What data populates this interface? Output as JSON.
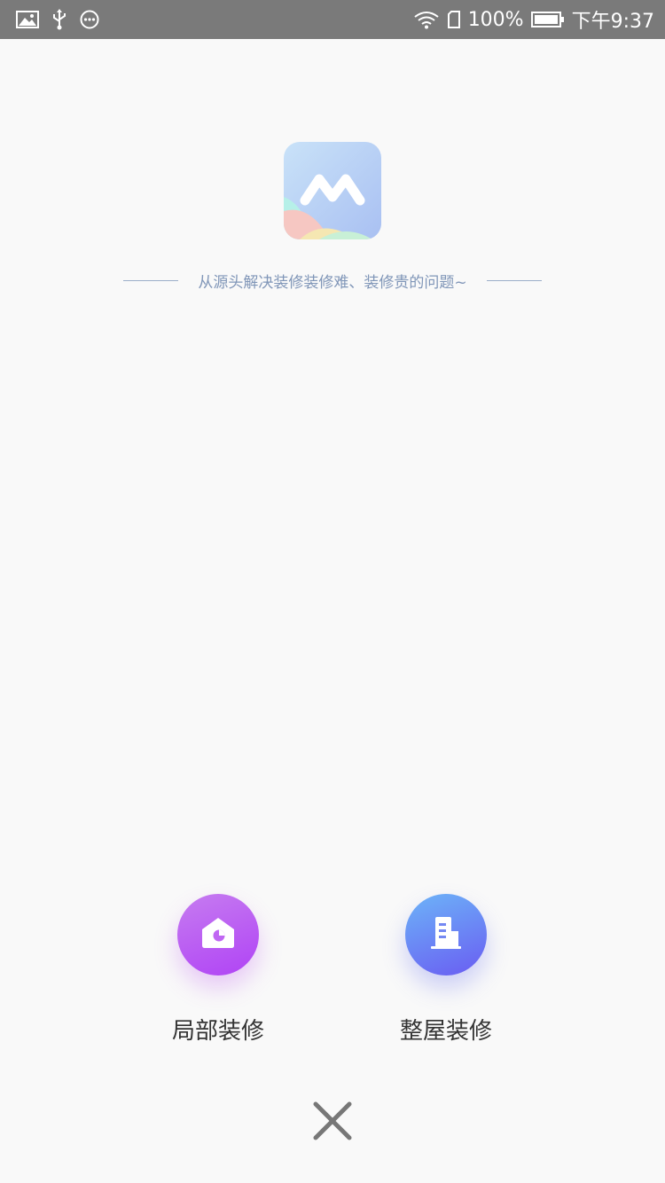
{
  "status_bar": {
    "battery_percent": "100%",
    "time": "下午9:37",
    "icons": [
      "image-icon",
      "usb-icon",
      "more-icon",
      "wifi-icon",
      "sim-icon",
      "battery-icon"
    ]
  },
  "header": {
    "logo_icon": "app-logo-icon",
    "tagline": "从源头解决装修装修难、装修贵的问题~"
  },
  "options": [
    {
      "label": "局部装修",
      "icon": "house-icon",
      "color": "#b455f4"
    },
    {
      "label": "整屋装修",
      "icon": "building-icon",
      "color": "#6a7cf4"
    }
  ],
  "close": {
    "icon": "close-icon"
  }
}
